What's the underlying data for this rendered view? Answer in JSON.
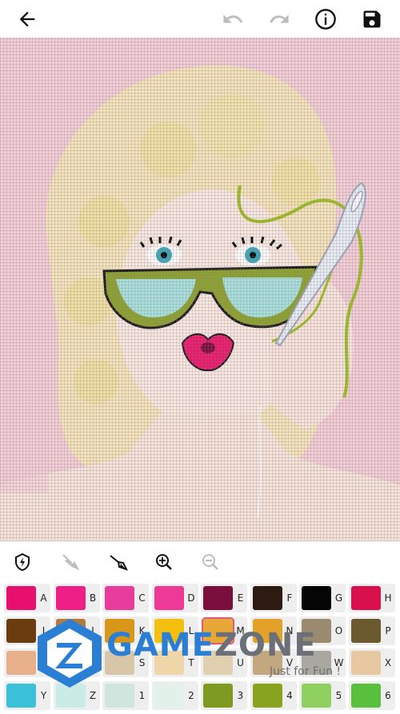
{
  "toolbar": {
    "back_icon": "arrow-left-icon",
    "undo_icon": "undo-icon",
    "redo_icon": "redo-icon",
    "info_icon": "info-icon",
    "save_icon": "save-icon"
  },
  "tools": [
    {
      "name": "auto-fill-icon",
      "enabled": true
    },
    {
      "name": "needle-disabled-icon",
      "enabled": false
    },
    {
      "name": "needle-icon",
      "enabled": true
    },
    {
      "name": "zoom-in-icon",
      "enabled": true
    },
    {
      "name": "zoom-out-icon",
      "enabled": false
    }
  ],
  "palette": [
    [
      {
        "code": "A",
        "color": "#e8106f"
      },
      {
        "code": "B",
        "color": "#ee1f86"
      },
      {
        "code": "C",
        "color": "#e83c9c"
      },
      {
        "code": "D",
        "color": "#ec3a96"
      },
      {
        "code": "E",
        "color": "#7a0f3d"
      },
      {
        "code": "F",
        "color": "#2d1a10"
      },
      {
        "code": "G",
        "color": "#050505"
      },
      {
        "code": "H",
        "color": "#d8104d"
      }
    ],
    [
      {
        "code": "I",
        "color": "#6a3c10"
      },
      {
        "code": "J",
        "color": "#b07a40"
      },
      {
        "code": "K",
        "color": "#d9971a"
      },
      {
        "code": "L",
        "color": "#f3c010"
      },
      {
        "code": "M",
        "color": "#e8a838",
        "selected": true
      },
      {
        "code": "N",
        "color": "#e3a12a"
      },
      {
        "code": "O",
        "color": "#9a8a70"
      },
      {
        "code": "P",
        "color": "#6b5a30"
      }
    ],
    [
      {
        "code": "Q",
        "color": "#e7b08a"
      },
      {
        "code": "R",
        "color": "#c88060"
      },
      {
        "code": "S",
        "color": "#d7c7a8"
      },
      {
        "code": "T",
        "color": "#efd6a8"
      },
      {
        "code": "U",
        "color": "#e0d0b0"
      },
      {
        "code": "V",
        "color": "#c2a880"
      },
      {
        "code": "W",
        "color": "#a8a8a0"
      },
      {
        "code": "X",
        "color": "#e8c8a0"
      }
    ],
    [
      {
        "code": "Y",
        "color": "#3ac0d8"
      },
      {
        "code": "Z",
        "color": "#c9ede6"
      },
      {
        "code": "1",
        "color": "#cfe6de"
      },
      {
        "code": "2",
        "color": "#e2f2ea"
      },
      {
        "code": "3",
        "color": "#7e9a20"
      },
      {
        "code": "4",
        "color": "#88a41e"
      },
      {
        "code": "5",
        "color": "#8fd060"
      },
      {
        "code": "6",
        "color": "#58c03c"
      }
    ]
  ],
  "watermark": {
    "part1": "GAME",
    "part2": "ZONE",
    "tagline": "Just for Fun !"
  }
}
